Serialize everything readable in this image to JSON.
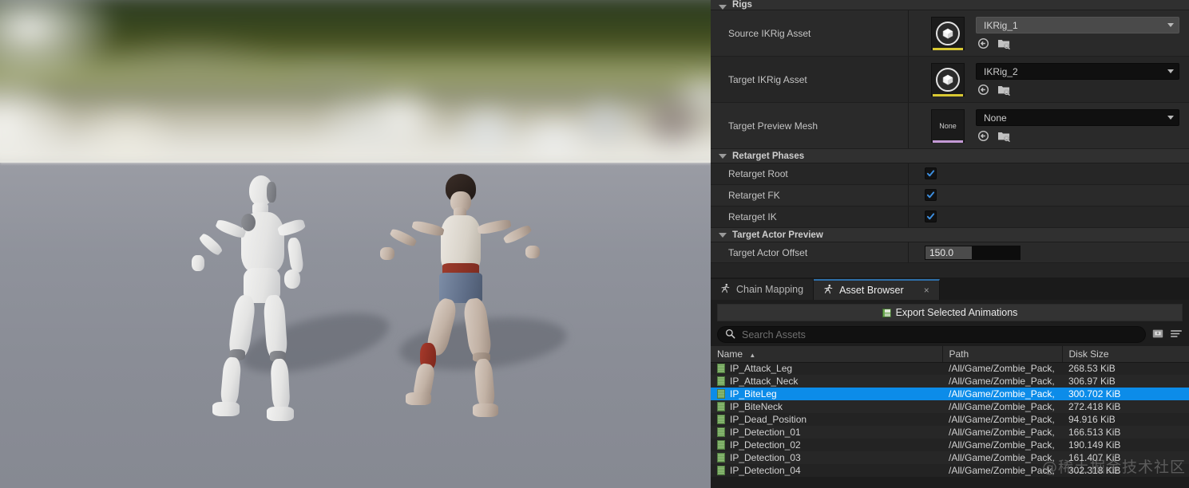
{
  "viewport": {
    "name": "retarget-preview-viewport",
    "source_character": "mannequin",
    "target_character": "zombie"
  },
  "panel": {
    "sections": [
      {
        "title": "Rigs"
      },
      {
        "title": "Retarget Phases"
      },
      {
        "title": "Target Actor Preview"
      }
    ],
    "rigs": {
      "title": "Rigs",
      "rows": [
        {
          "label": "Source IKRig Asset",
          "value": "IKRig_1",
          "thumb": "cube-asset-icon",
          "thumb_accent": "#d8c832",
          "thumb_text": ""
        },
        {
          "label": "Target IKRig Asset",
          "value": "IKRig_2",
          "thumb": "cube-asset-icon",
          "thumb_accent": "#d8c832",
          "thumb_text": ""
        },
        {
          "label": "Target Preview Mesh",
          "value": "None",
          "thumb": "none-thumbnail",
          "thumb_accent": "#c49ad6",
          "thumb_text": "None"
        }
      ]
    },
    "retarget_phases": {
      "title": "Retarget Phases",
      "rows": [
        {
          "label": "Retarget Root",
          "checked": true
        },
        {
          "label": "Retarget FK",
          "checked": true
        },
        {
          "label": "Retarget IK",
          "checked": true
        }
      ]
    },
    "target_actor_preview": {
      "title": "Target Actor Preview",
      "offset_label": "Target Actor Offset",
      "offset_value": "150.0"
    }
  },
  "dock": {
    "tabs": [
      {
        "label": "Chain Mapping",
        "active": false,
        "closable": false
      },
      {
        "label": "Asset Browser",
        "active": true,
        "closable": true,
        "close_label": "×"
      }
    ],
    "export_button": "Export Selected Animations",
    "search": {
      "placeholder": "Search Assets",
      "value": ""
    },
    "table": {
      "columns": [
        "Name",
        "Path",
        "Disk Size"
      ],
      "sort_column": "Name",
      "sort_indicator": "▲",
      "rows": [
        {
          "name": "IP_Attack_Leg",
          "path": "/All/Game/Zombie_Pack,",
          "size": "268.53 KiB",
          "selected": false
        },
        {
          "name": "IP_Attack_Neck",
          "path": "/All/Game/Zombie_Pack,",
          "size": "306.97 KiB",
          "selected": false
        },
        {
          "name": "IP_BiteLeg",
          "path": "/All/Game/Zombie_Pack,",
          "size": "300.702 KiB",
          "selected": true
        },
        {
          "name": "IP_BiteNeck",
          "path": "/All/Game/Zombie_Pack,",
          "size": "272.418 KiB",
          "selected": false
        },
        {
          "name": "IP_Dead_Position",
          "path": "/All/Game/Zombie_Pack,",
          "size": "94.916 KiB",
          "selected": false
        },
        {
          "name": "IP_Detection_01",
          "path": "/All/Game/Zombie_Pack,",
          "size": "166.513 KiB",
          "selected": false
        },
        {
          "name": "IP_Detection_02",
          "path": "/All/Game/Zombie_Pack,",
          "size": "190.149 KiB",
          "selected": false
        },
        {
          "name": "IP_Detection_03",
          "path": "/All/Game/Zombie_Pack,",
          "size": "161.407 KiB",
          "selected": false
        },
        {
          "name": "IP_Detection_04",
          "path": "/All/Game/Zombie_Pack,",
          "size": "302.318 KiB",
          "selected": false
        }
      ]
    }
  },
  "watermark": "@稀土掘金技术社区",
  "colors": {
    "selection_blue": "#0c8ce9",
    "checkbox_blue": "#3d8fe0",
    "accent_yellow": "#d8c832",
    "accent_purple": "#c49ad6",
    "tab_active_underline": "#2f6fa8"
  }
}
